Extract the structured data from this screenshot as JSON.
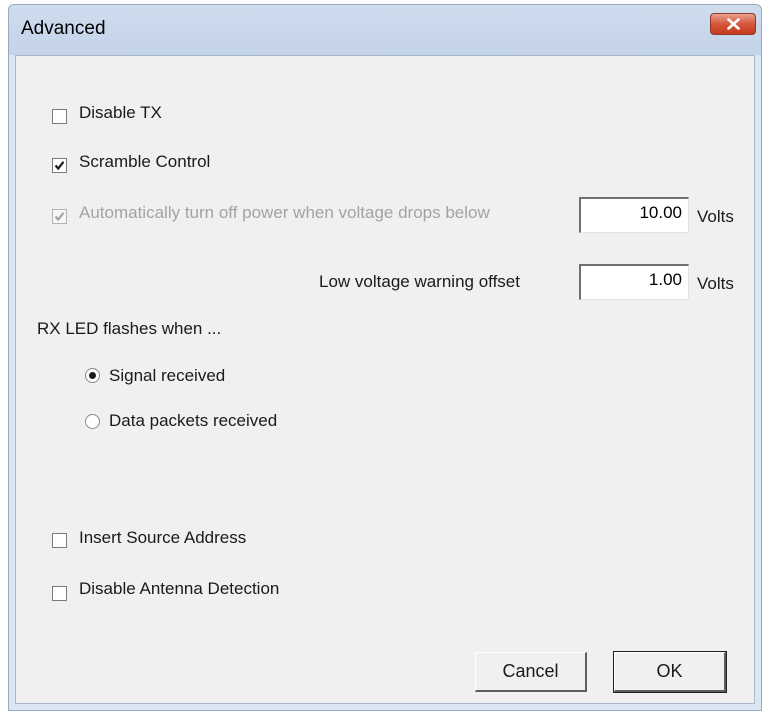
{
  "window": {
    "title": "Advanced"
  },
  "options": {
    "disable_tx": {
      "label": "Disable TX",
      "checked": false
    },
    "scramble_control": {
      "label": "Scramble Control",
      "checked": true
    },
    "auto_power_off": {
      "label": "Automatically turn off power when voltage drops below",
      "checked": true,
      "enabled": false,
      "value": "10.00",
      "unit": "Volts"
    },
    "low_voltage_offset": {
      "label": "Low voltage warning offset",
      "value": "1.00",
      "unit": "Volts"
    }
  },
  "rx_led": {
    "heading": "RX LED flashes when ...",
    "signal_received": {
      "label": "Signal received",
      "selected": true
    },
    "data_packets_received": {
      "label": "Data packets received",
      "selected": false
    }
  },
  "extra": {
    "insert_source_address": {
      "label": "Insert Source Address",
      "checked": false
    },
    "disable_antenna_detection": {
      "label": "Disable Antenna Detection",
      "checked": false
    }
  },
  "buttons": {
    "cancel": "Cancel",
    "ok": "OK"
  },
  "icons": {
    "close": "close-icon",
    "check": "checkmark-icon"
  },
  "colors": {
    "title_bar": "#c8d7ec",
    "close_button": "#d5573c",
    "client_bg": "#f0f0f0",
    "disabled_text": "#a3a3a3"
  }
}
